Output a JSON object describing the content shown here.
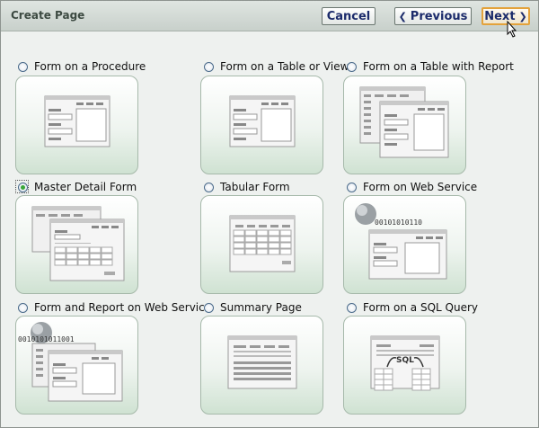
{
  "header": {
    "title": "Create Page",
    "cancel_label": "Cancel",
    "previous_label": "Previous",
    "next_label": "Next"
  },
  "options": [
    {
      "label": "Form on a Procedure",
      "selected": false,
      "icon": "form-procedure-icon"
    },
    {
      "label": "Form on a Table or View",
      "selected": false,
      "icon": "form-table-icon"
    },
    {
      "label": "Form on a Table with Report",
      "selected": false,
      "icon": "form-report-icon"
    },
    {
      "label": "Master Detail Form",
      "selected": true,
      "icon": "master-detail-icon"
    },
    {
      "label": "Tabular Form",
      "selected": false,
      "icon": "tabular-form-icon"
    },
    {
      "label": "Form on Web Service",
      "selected": false,
      "icon": "web-service-form-icon"
    },
    {
      "label": "Form and Report on Web Service",
      "selected": false,
      "icon": "web-service-report-icon"
    },
    {
      "label": "Summary Page",
      "selected": false,
      "icon": "summary-page-icon"
    },
    {
      "label": "Form on a SQL Query",
      "selected": false,
      "icon": "sql-query-icon"
    }
  ],
  "illustration_text": {
    "binary_a": "00101010110",
    "binary_b": "0010101011001",
    "sql": "SQL"
  },
  "colors": {
    "tile_green": "#cfe2d2",
    "next_border": "#e3a23b",
    "radio_selected": "#38a638"
  }
}
